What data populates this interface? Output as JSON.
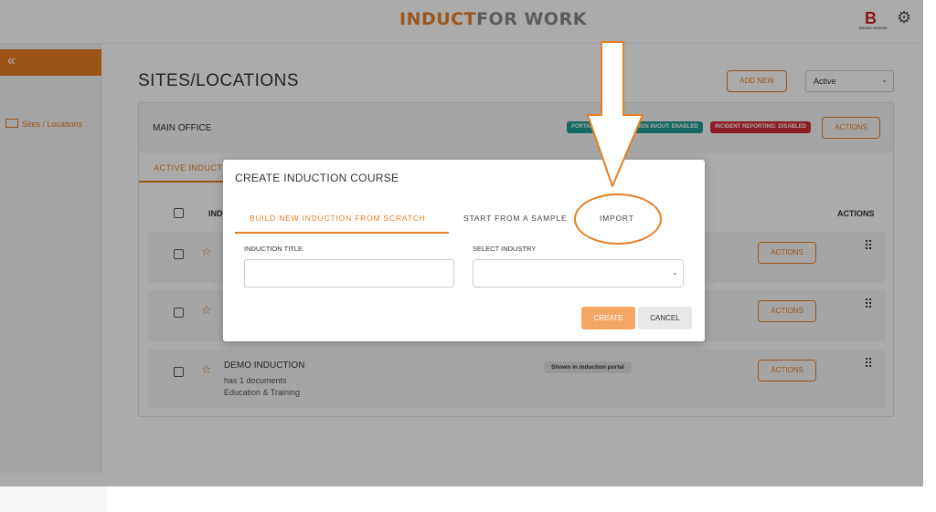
{
  "header": {
    "logo_part1": "INDUCT",
    "logo_part2": "FOR WORK",
    "brand_glyph": "B",
    "brand_caption": "BRAND DESIGN"
  },
  "sidebar": {
    "collapse_glyph": "«",
    "items": [
      {
        "label": "Sites / Locations"
      }
    ]
  },
  "main": {
    "page_title": "SITES/LOCATIONS",
    "add_new_label": "ADD NEW",
    "status_filter": "Active",
    "site": {
      "name": "MAIN OFFICE",
      "badges": {
        "portal": "PORTAL: ENABLED",
        "sign": "SIGN IN/OUT: ENABLED",
        "incident": "INCIDENT REPORTING: DISABLED"
      },
      "actions_label": "ACTIONS"
    },
    "tab_active": "ACTIVE INDUCTIONS",
    "table": {
      "col_title": "INDUCTION",
      "col_actions": "ACTIONS",
      "rows": [
        {
          "title": "",
          "sub1": "",
          "sub2": "",
          "tag": "",
          "actions": "ACTIONS"
        },
        {
          "title": "",
          "sub1": "",
          "sub2": "",
          "tag": "",
          "actions": "ACTIONS"
        },
        {
          "title": "DEMO INDUCTION",
          "sub1": "has 1 documents",
          "sub2": "Education & Training",
          "tag": "Shown in induction portal",
          "actions": "ACTIONS"
        }
      ]
    }
  },
  "modal": {
    "title": "CREATE INDUCTION COURSE",
    "tabs": {
      "build": "BUILD NEW INDUCTION FROM SCRATCH",
      "sample": "START FROM A SAMPLE",
      "import": "IMPORT"
    },
    "fields": {
      "title_label": "INDUCTION TITLE",
      "title_value": "",
      "industry_label": "SELECT INDUSTRY",
      "industry_value": ""
    },
    "create_label": "CREATE",
    "cancel_label": "CANCEL"
  },
  "colors": {
    "accent": "#e67e22",
    "portal_badge": "#1f9e8f",
    "incident_badge": "#d42b3a"
  }
}
